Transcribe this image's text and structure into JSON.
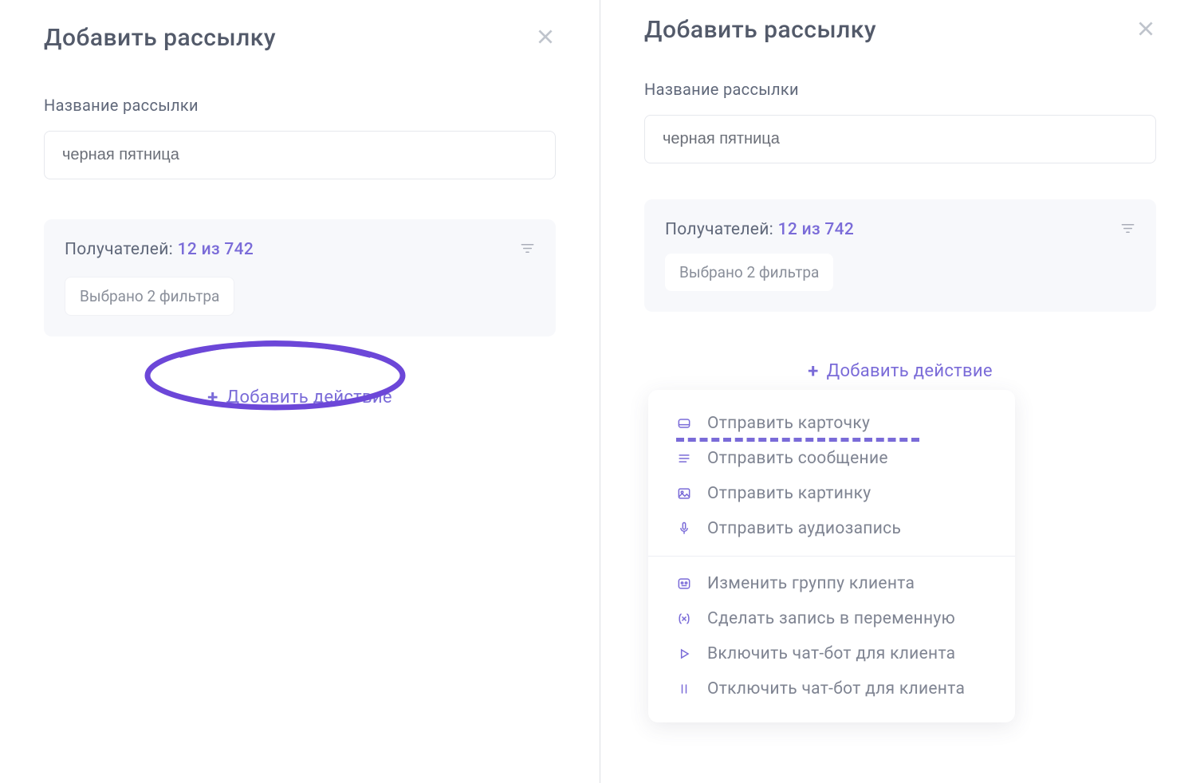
{
  "left": {
    "title": "Добавить рассылку",
    "name_label": "Название рассылки",
    "name_value": "черная пятница",
    "recipients_label": "Получателей:",
    "recipients_count": "12 из 742",
    "filters_chip": "Выбрано 2 фильтра",
    "add_action": "Добавить действие"
  },
  "right": {
    "title": "Добавить рассылку",
    "name_label": "Название рассылки",
    "name_value": "черная пятница",
    "recipients_label": "Получателей:",
    "recipients_count": "12 из 742",
    "filters_chip": "Выбрано 2 фильтра",
    "add_action": "Добавить действие",
    "menu": {
      "send_card": "Отправить карточку",
      "send_message": "Отправить сообщение",
      "send_image": "Отправить картинку",
      "send_audio": "Отправить аудиозапись",
      "change_group": "Изменить группу клиента",
      "write_variable": "Сделать запись в переменную",
      "enable_chatbot": "Включить чат-бот для клиента",
      "disable_chatbot": "Отключить чат-бот для клиента"
    }
  }
}
